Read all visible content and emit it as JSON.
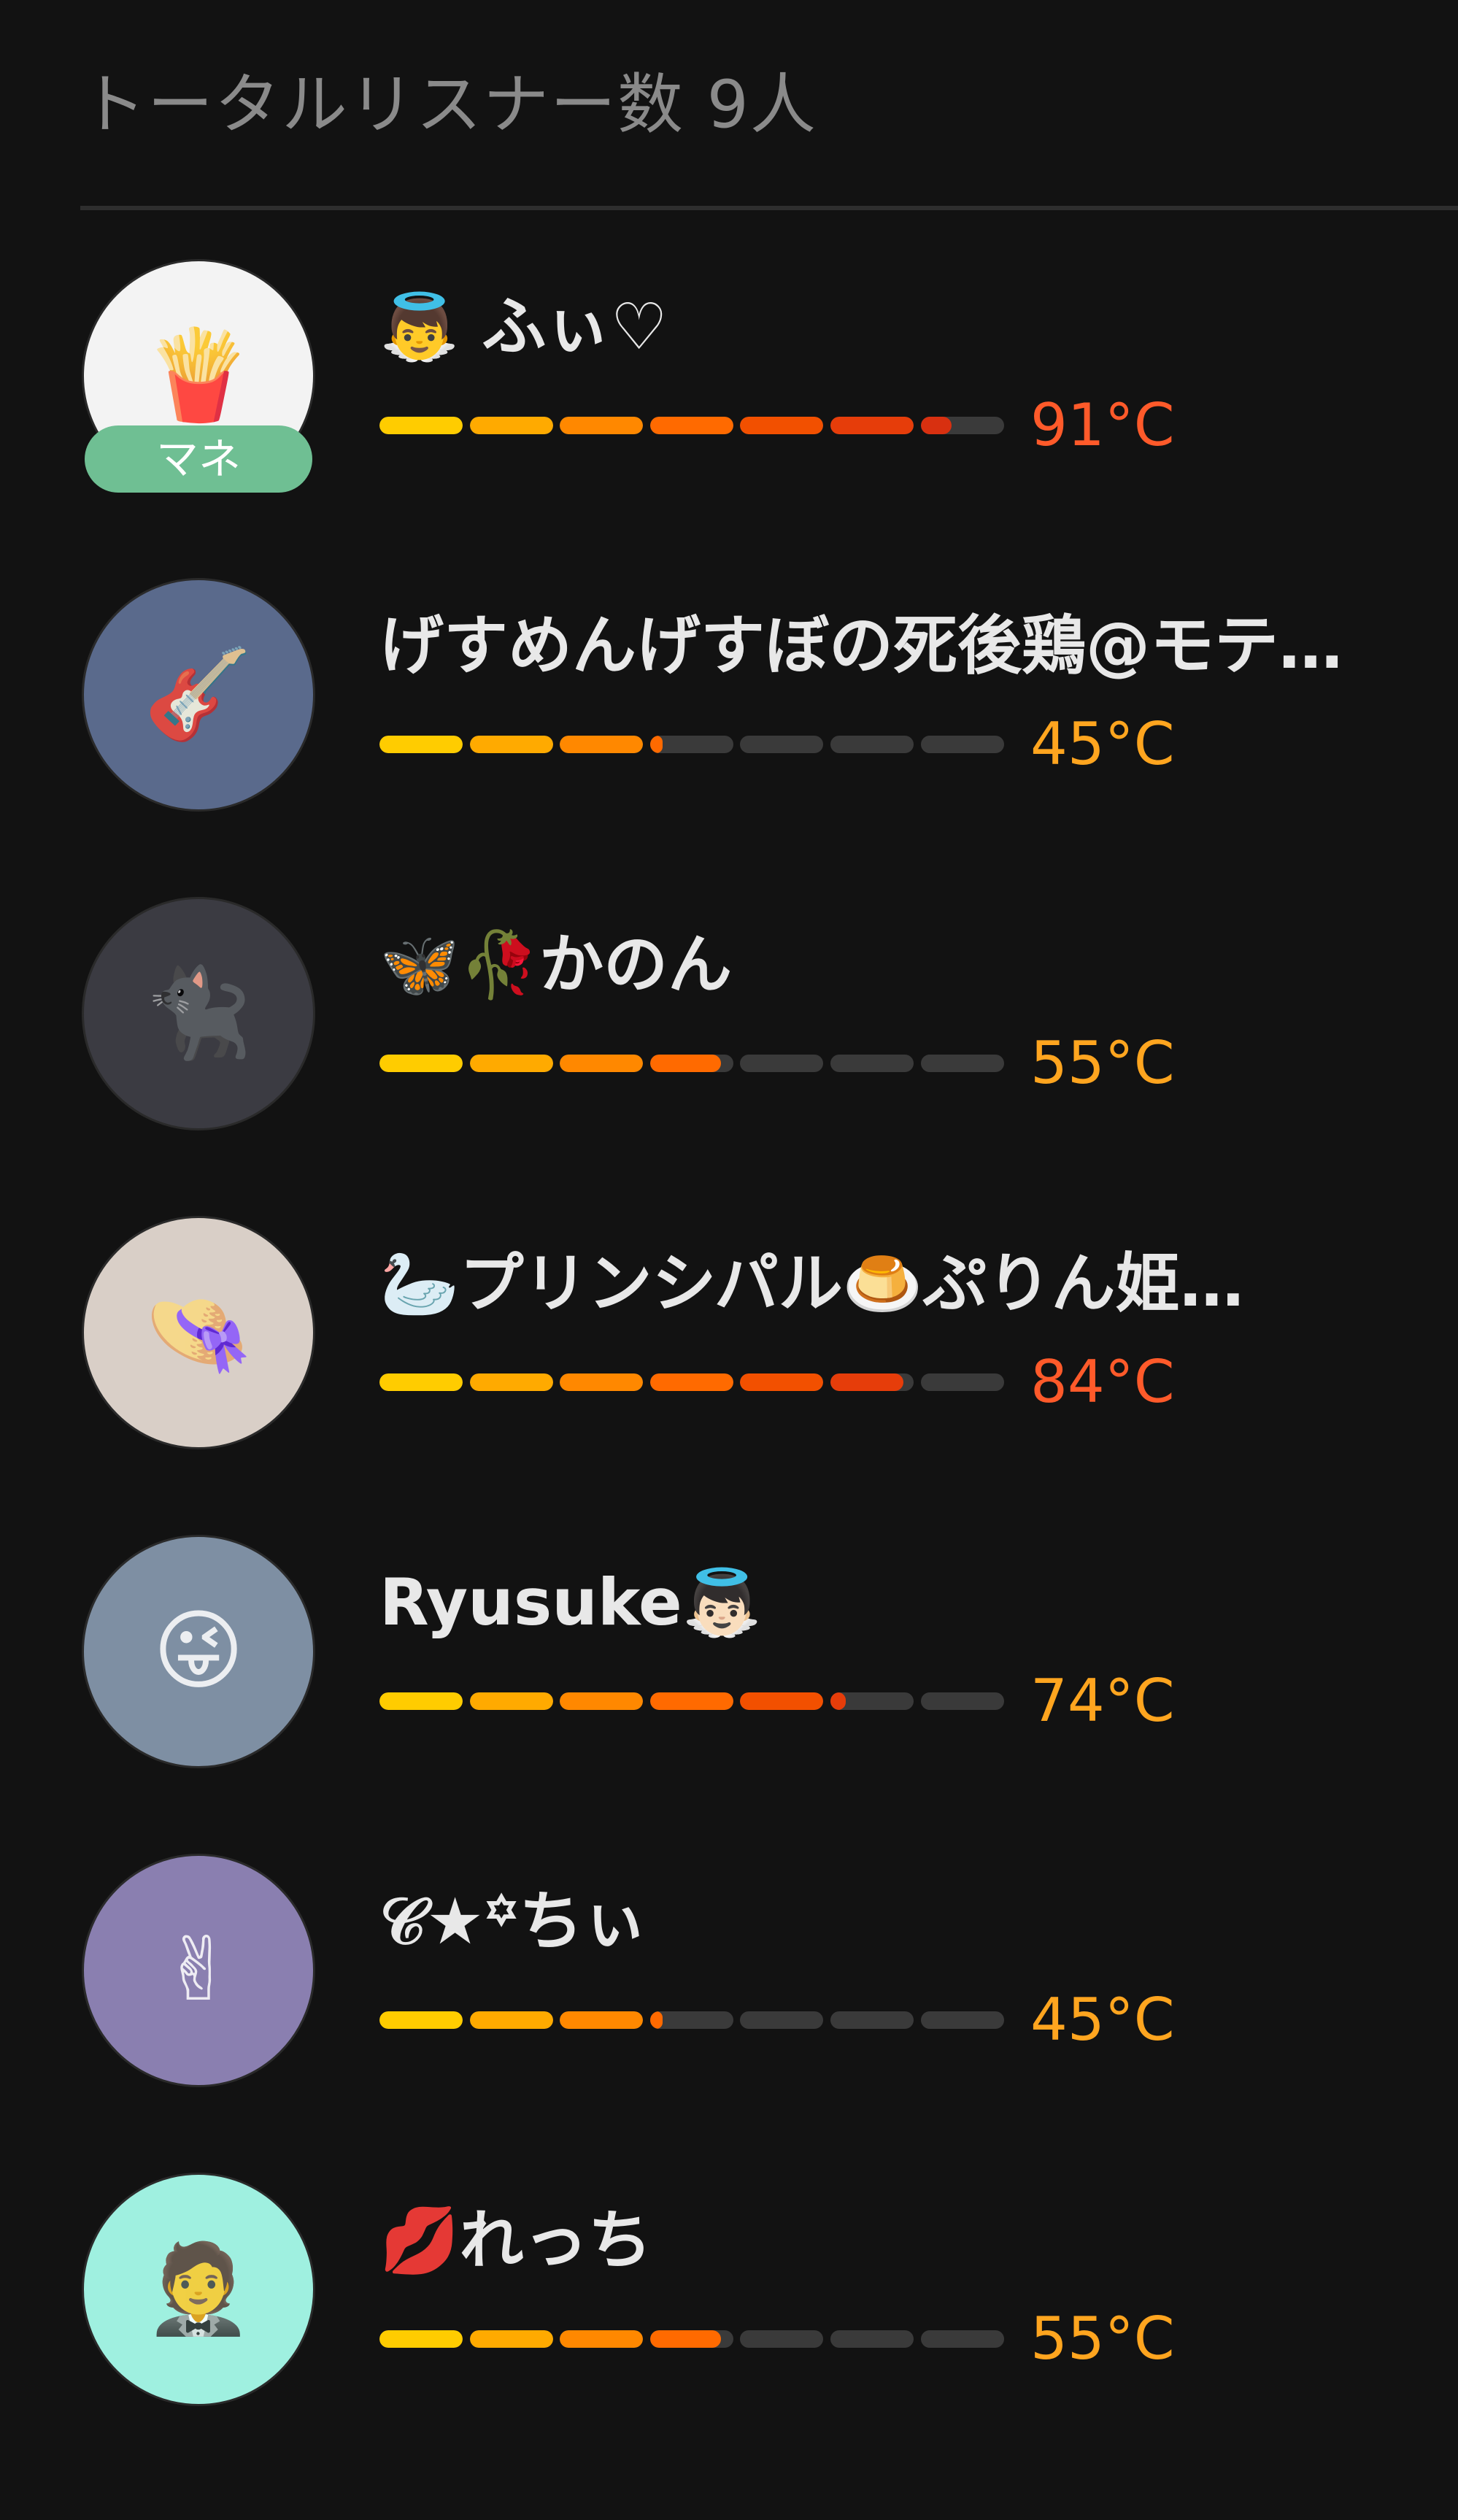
{
  "header": {
    "title": "トータルリスナー数 9人"
  },
  "colors": {
    "segments": [
      "#ffcc00",
      "#ffaa00",
      "#ff8800",
      "#ff6a00",
      "#f25000",
      "#e63d0a",
      "#d83010"
    ],
    "empty": "#3a3a3a",
    "temp_hot": "#ff5a2a",
    "temp_warm": "#ffa51f",
    "badge": "#6fbf93"
  },
  "listeners": [
    {
      "name": "👼 ふぃ♡",
      "temp_label": "91°C",
      "temp_value": 91,
      "temp_color": "#ff5a2a",
      "badge": "マネ",
      "avatar_icon": "fries-icon",
      "avatar_glyph": "🍟",
      "avatar_bg": "#f3f3f3"
    },
    {
      "name": "げすめんげすぼの死後鶏@モテ…",
      "temp_label": "45°C",
      "temp_value": 45,
      "temp_color": "#ffa51f",
      "badge": "",
      "avatar_icon": "photo-icon",
      "avatar_glyph": "🎸",
      "avatar_bg": "#5a6a8c"
    },
    {
      "name": "🦋🥀かのん",
      "temp_label": "55°C",
      "temp_value": 55,
      "temp_color": "#ffa51f",
      "badge": "",
      "avatar_icon": "anime-girl-icon",
      "avatar_glyph": "🐈‍⬛",
      "avatar_bg": "#3b3b42"
    },
    {
      "name": "🦢プリンシパル🍮ぷりん姫…",
      "temp_label": "84°C",
      "temp_value": 84,
      "temp_color": "#ff5a2a",
      "badge": "",
      "avatar_icon": "portrait-icon",
      "avatar_glyph": "👒",
      "avatar_bg": "#d9cfc7"
    },
    {
      "name": "Ryusuke👼🏻",
      "temp_label": "74°C",
      "temp_value": 74,
      "temp_color": "#ffa51f",
      "badge": "",
      "avatar_icon": "group-photo-icon",
      "avatar_glyph": "😜",
      "avatar_bg": "#7e8fa3"
    },
    {
      "name": "𝒞★꙳ちぃ",
      "temp_label": "45°C",
      "temp_value": 45,
      "temp_color": "#ffa51f",
      "badge": "",
      "avatar_icon": "illustration-icon",
      "avatar_glyph": "✌",
      "avatar_bg": "#8a7fb0"
    },
    {
      "name": "💋れっち",
      "temp_label": "55°C",
      "temp_value": 55,
      "temp_color": "#ffa51f",
      "badge": "",
      "avatar_icon": "chibi-character-icon",
      "avatar_glyph": "🤵",
      "avatar_bg": "#9ff0e0"
    }
  ]
}
